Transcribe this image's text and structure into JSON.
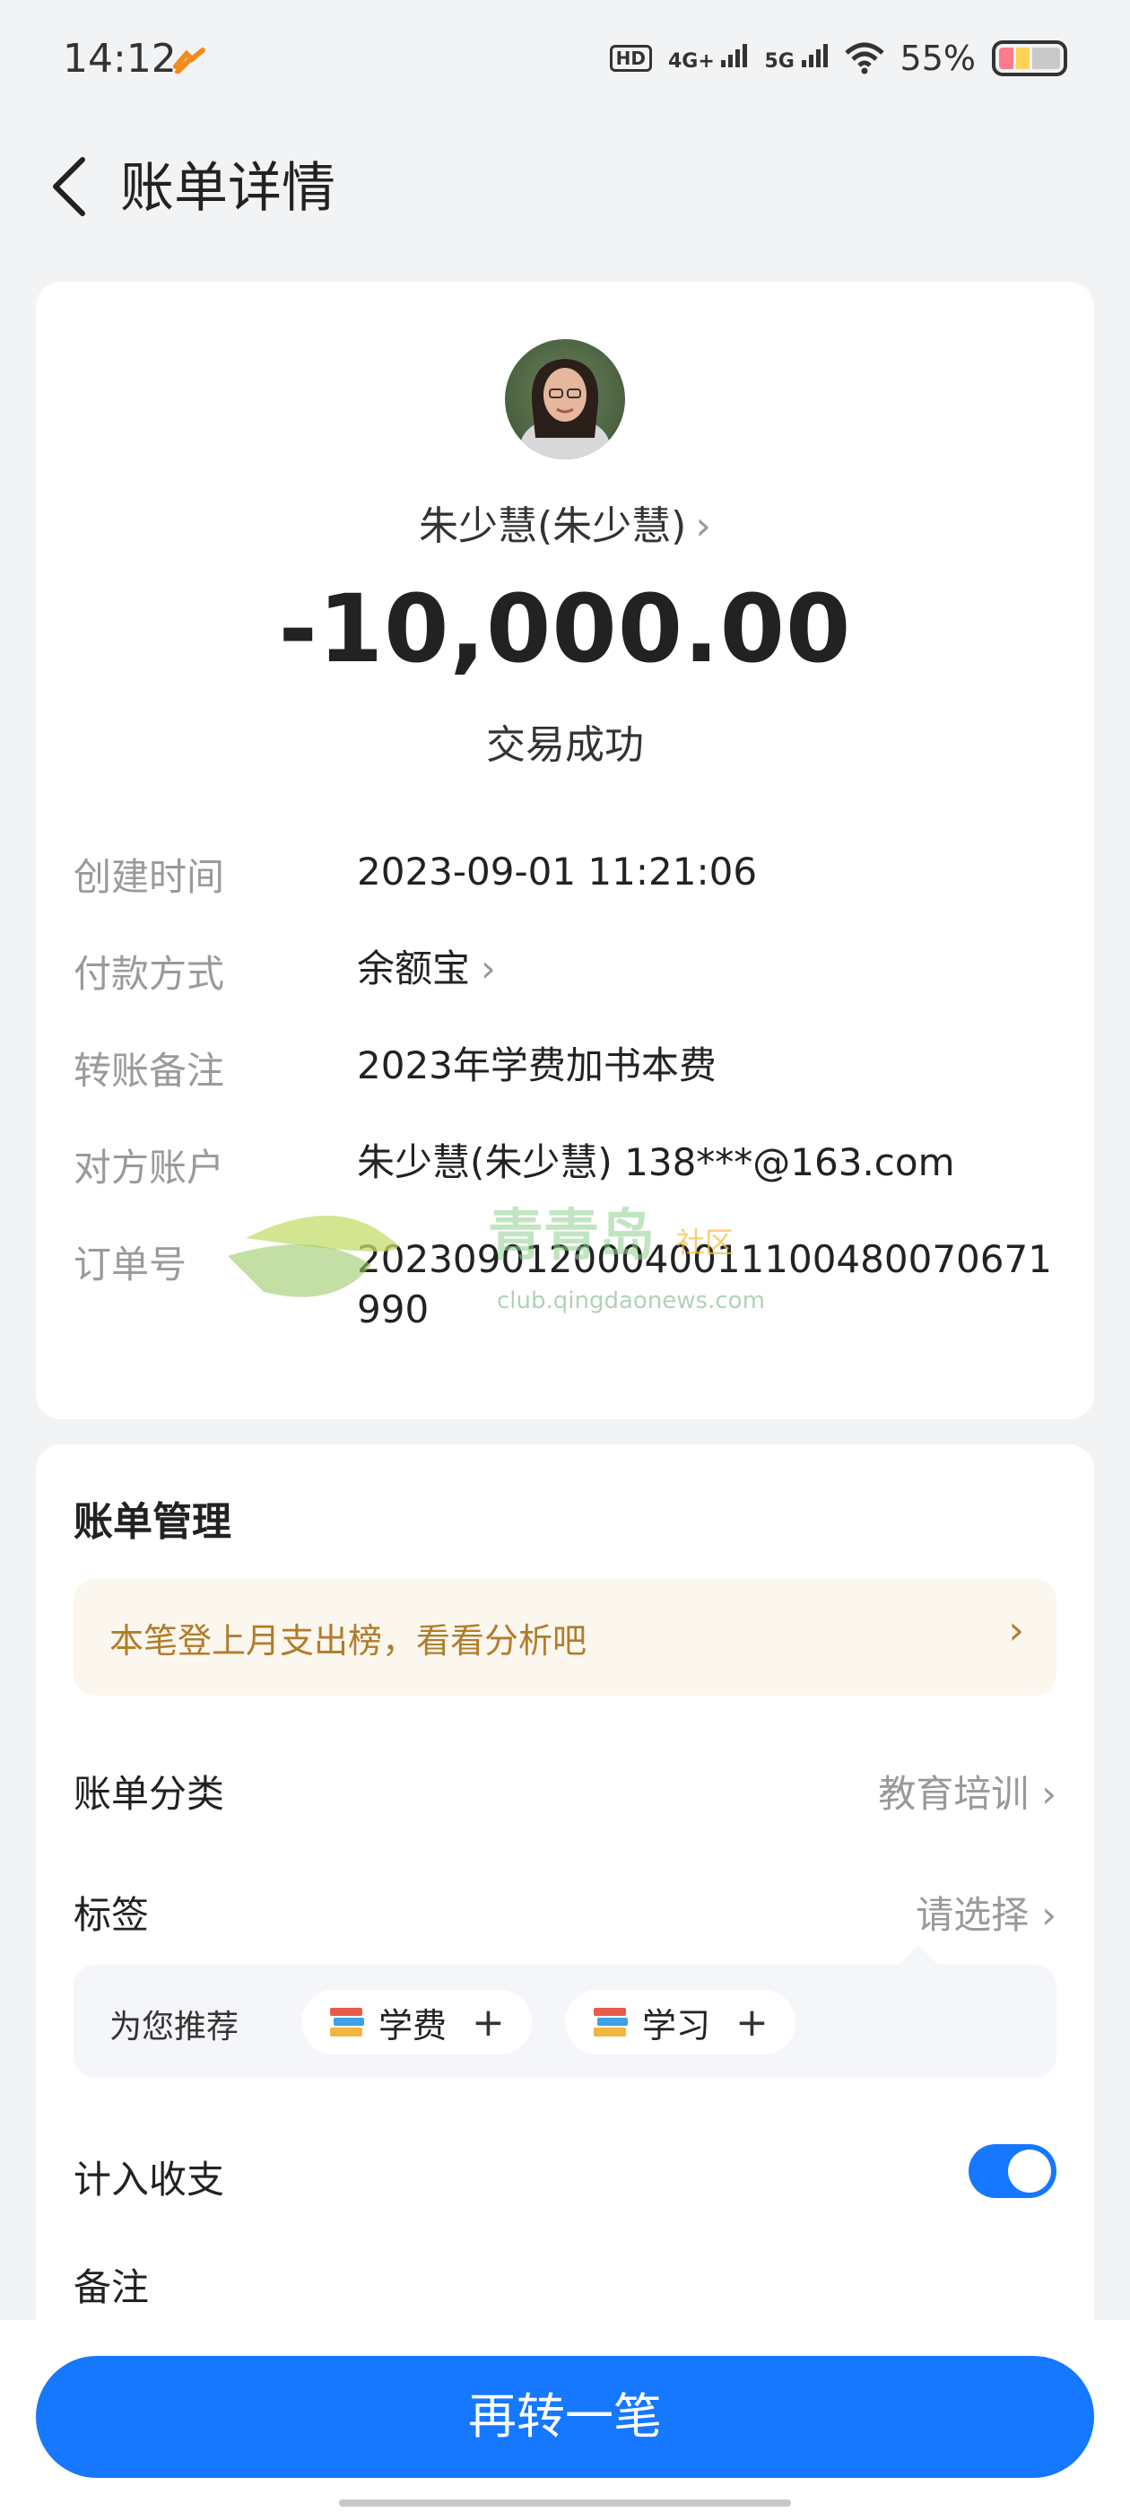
{
  "status_bar": {
    "time": "14:12",
    "hd": "HD",
    "net1": "4G+",
    "net2": "5G",
    "battery": "55%"
  },
  "header": {
    "title": "账单详情"
  },
  "transaction": {
    "payee": "朱少慧(朱少慧)",
    "amount": "-10,000.00",
    "status": "交易成功"
  },
  "details": [
    {
      "label": "创建时间",
      "value": "2023-09-01 11:21:06"
    },
    {
      "label": "付款方式",
      "value": "余额宝"
    },
    {
      "label": "转账备注",
      "value": "2023年学费加书本费"
    },
    {
      "label": "对方账户",
      "value": "朱少慧(朱少慧) 138***@163.com"
    },
    {
      "label": "订单号",
      "value": "20230901200040011100480070671990"
    }
  ],
  "watermark": {
    "logo_text": "青青岛",
    "suffix": "社区",
    "url": "club.qingdaonews.com"
  },
  "manage": {
    "title": "账单管理",
    "banner": "本笔登上月支出榜，看看分析吧",
    "category_label": "账单分类",
    "category_value": "教育培训",
    "tag_label": "标签",
    "tag_value": "请选择",
    "recommend_label": "为您推荐",
    "chips": [
      "学费",
      "学习"
    ],
    "include_label": "计入收支",
    "include_on": true,
    "note_label": "备注"
  },
  "bottom": {
    "button": "再转一笔"
  },
  "colors": {
    "accent": "#1677ff",
    "banner_text": "#b07d2b"
  }
}
